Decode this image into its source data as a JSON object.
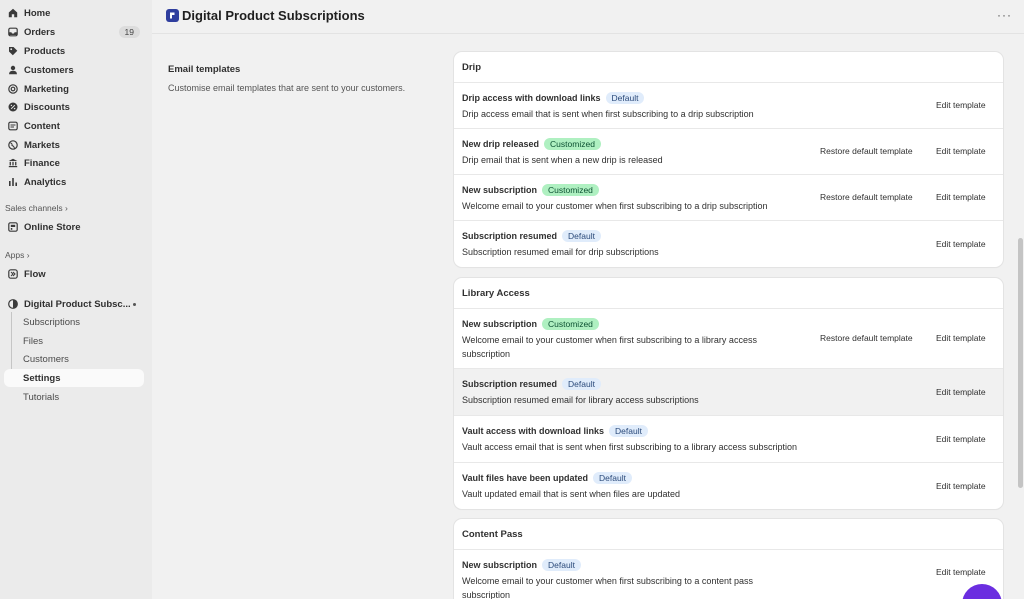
{
  "sidebar": {
    "nav": [
      {
        "label": "Home",
        "icon": "home-icon"
      },
      {
        "label": "Orders",
        "icon": "orders-icon",
        "count": "19"
      },
      {
        "label": "Products",
        "icon": "tag-icon"
      },
      {
        "label": "Customers",
        "icon": "person-icon"
      },
      {
        "label": "Marketing",
        "icon": "target-icon"
      },
      {
        "label": "Discounts",
        "icon": "discount-icon"
      },
      {
        "label": "Content",
        "icon": "content-icon"
      },
      {
        "label": "Markets",
        "icon": "globe-icon"
      },
      {
        "label": "Finance",
        "icon": "bank-icon"
      },
      {
        "label": "Analytics",
        "icon": "bar-chart-icon"
      }
    ],
    "sales_channels_label": "Sales channels",
    "online_store_label": "Online Store",
    "apps_label": "Apps",
    "flow_label": "Flow",
    "app_name": "Digital Product Subsc...",
    "app_sub_items": [
      "Subscriptions",
      "Files",
      "Customers",
      "Settings",
      "Tutorials"
    ],
    "active_sub_item": "Settings"
  },
  "header": {
    "title": "Digital Product Subscriptions",
    "more_label": "···"
  },
  "description": {
    "title": "Email templates",
    "text": "Customise email templates that are sent to your customers."
  },
  "actions": {
    "edit": "Edit template",
    "restore": "Restore default template"
  },
  "cards": [
    {
      "title": "Drip",
      "rows": [
        {
          "name": "Drip access with download links",
          "badge": "Default",
          "desc": "Drip access email that is sent when first subscribing to a drip subscription",
          "restore": false
        },
        {
          "name": "New drip released",
          "badge": "Customized",
          "desc": "Drip email that is sent when a new drip is released",
          "restore": true
        },
        {
          "name": "New subscription",
          "badge": "Customized",
          "desc": "Welcome email to your customer when first subscribing to a drip subscription",
          "restore": true
        },
        {
          "name": "Subscription resumed",
          "badge": "Default",
          "desc": "Subscription resumed email for drip subscriptions",
          "restore": false
        }
      ]
    },
    {
      "title": "Library Access",
      "rows": [
        {
          "name": "New subscription",
          "badge": "Customized",
          "desc": "Welcome email to your customer when first subscribing to a library access subscription",
          "restore": true
        },
        {
          "name": "Subscription resumed",
          "badge": "Default",
          "desc": "Subscription resumed email for library access subscriptions",
          "restore": false
        },
        {
          "name": "Vault access with download links",
          "badge": "Default",
          "desc": "Vault access email that is sent when first subscribing to a library access subscription",
          "restore": false
        },
        {
          "name": "Vault files have been updated",
          "badge": "Default",
          "desc": "Vault updated email that is sent when files are updated",
          "restore": false
        }
      ]
    },
    {
      "title": "Content Pass",
      "rows": [
        {
          "name": "New subscription",
          "badge": "Default",
          "desc": "Welcome email to your customer when first subscribing to a content pass subscription",
          "restore": false
        }
      ]
    }
  ],
  "colors": {
    "badge_default_bg": "#e0ecfb",
    "badge_customized_bg": "#aff0c1",
    "app_logo": "#2f3e9e",
    "fab": "#6b2ee0"
  }
}
